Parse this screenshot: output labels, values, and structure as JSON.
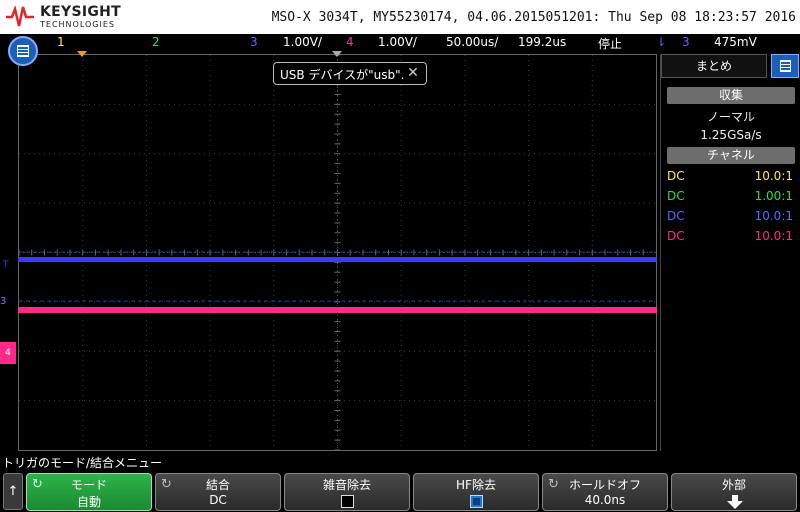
{
  "header": {
    "brand": "KEYSIGHT",
    "brand_sub": "TECHNOLOGIES",
    "instrument_info": "MSO-X 3034T, MY55230174, 04.06.2015051201: Thu Sep 08 18:23:57 2016"
  },
  "channel_bar": {
    "ch1": "1",
    "ch2": "2",
    "ch3": "3",
    "ch3_scale": "1.00V/",
    "ch4": "4",
    "ch4_scale": "1.00V/",
    "timebase": "50.00us/",
    "delay": "199.2us",
    "run_state": "停止",
    "trigger_icon": "⇂",
    "trigger_source": "3",
    "trigger_level": "475mV"
  },
  "toast": {
    "message": "USB デバイスが\"usb\"."
  },
  "markers": {
    "trig_level": "T",
    "ch3": "3",
    "ch4": "4"
  },
  "right_panel": {
    "tab_label": "まとめ",
    "acq_header": "収集",
    "acq_mode": "ノーマル",
    "sample_rate": "1.25GSa/s",
    "channel_header": "チャネル",
    "channels": [
      {
        "coupling": "DC",
        "ratio": "10.0:1",
        "color": "#ffee33"
      },
      {
        "coupling": "DC",
        "ratio": "1.00:1",
        "color": "#33dd33"
      },
      {
        "coupling": "DC",
        "ratio": "10.0:1",
        "color": "#5a66ff"
      },
      {
        "coupling": "DC",
        "ratio": "10.0:1",
        "color": "#ff2a8a"
      }
    ]
  },
  "softkeys": {
    "menu_title": "トリガのモード/結合メニュー",
    "back": "↑",
    "mode_label": "モード",
    "mode_value": "自動",
    "coupling_label": "結合",
    "coupling_value": "DC",
    "noise_reject_label": "雑音除去",
    "noise_reject_checked": false,
    "hf_reject_label": "HF除去",
    "hf_reject_checked": true,
    "holdoff_label": "ホールドオフ",
    "holdoff_value": "40.0ns",
    "external_label": "外部"
  },
  "colors": {
    "ch1": "#ffee33",
    "ch2": "#33dd33",
    "ch3": "#3b3bff",
    "ch4": "#ff2a8a",
    "trigger_pos": "#f29a22"
  }
}
